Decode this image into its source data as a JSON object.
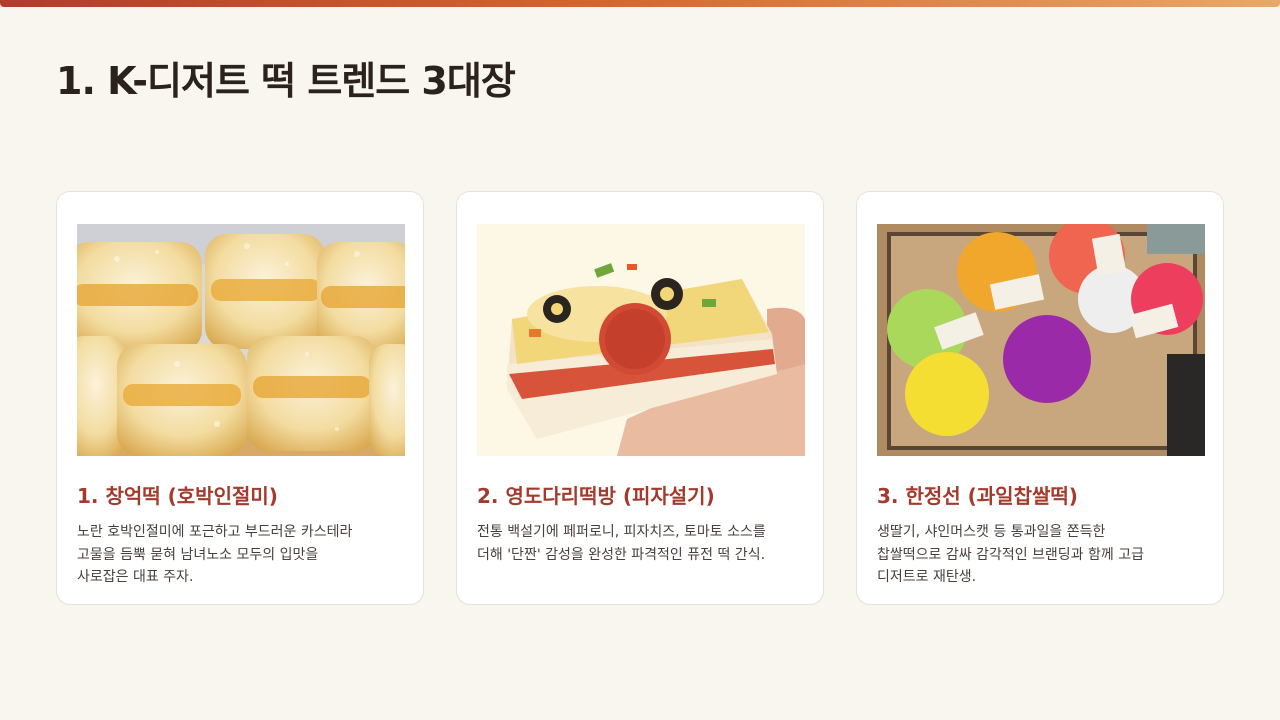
{
  "page": {
    "title": "1. K-디저트 떡 트렌드 3대장"
  },
  "colors": {
    "accent": "#a33a2b",
    "background": "#f9f6f0",
    "title": "#2b211d"
  },
  "cards": [
    {
      "title": "1. 창억떡 (호박인절미)",
      "desc_lines": [
        "노란 호박인절미에 포근하고 부드러운 카스테라",
        "고물을 듬뿍 묻혀 남녀노소 모두의 입맛을",
        "사로잡은 대표 주자."
      ]
    },
    {
      "title": "2. 영도다리떡방 (피자설기)",
      "desc_lines": [
        "전통 백설기에 페퍼로니, 피자치즈, 토마토 소스를",
        "더해 '단짠' 감성을 완성한 파격적인 퓨전 떡 간식."
      ]
    },
    {
      "title": "3. 한정선 (과일찹쌀떡)",
      "desc_lines": [
        "생딸기, 샤인머스캣 등 통과일을 쫀득한",
        "찹쌀떡으로 감싸 감각적인 브랜딩과 함께 고급",
        "디저트로 재탄생."
      ]
    }
  ]
}
